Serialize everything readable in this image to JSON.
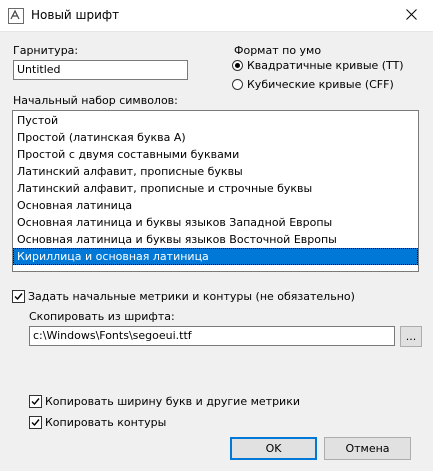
{
  "window": {
    "title": "Новый шрифт",
    "close_glyph": "✕"
  },
  "typeface": {
    "label": "Гарнитура:",
    "value": "Untitled"
  },
  "format": {
    "label": "Формат по умо",
    "options": [
      {
        "label": "Квадратичные кривые (TT)",
        "selected": true
      },
      {
        "label": "Кубические кривые (CFF)",
        "selected": false
      }
    ]
  },
  "charset": {
    "label": "Начальный набор символов:",
    "items": [
      "Пустой",
      "Простой (латинская буква А)",
      "Простой с двумя составными буквами",
      "Латинский алфавит, прописные буквы",
      "Латинский алфавит, прописные и строчные буквы",
      "Основная латиница",
      "Основная латиница и буквы языков Западной Европы",
      "Основная латиница и буквы языков Восточной Европы",
      "Кириллица и основная латиница"
    ],
    "selected_index": 8,
    "selection_color": "#0078d7"
  },
  "metrics": {
    "checkbox_label": "Задать начальные метрики и контуры (не обязательно)",
    "checked": true,
    "copy_from_label": "Скопировать из шрифта:",
    "path": "c:\\Windows\\Fonts\\segoeui.ttf",
    "browse_label": "...",
    "copy_widths_label": "Копировать ширину букв и другие метрики",
    "copy_widths_checked": true,
    "copy_outlines_label": "Копировать контуры",
    "copy_outlines_checked": true
  },
  "buttons": {
    "ok": "OK",
    "cancel": "Отмена"
  }
}
